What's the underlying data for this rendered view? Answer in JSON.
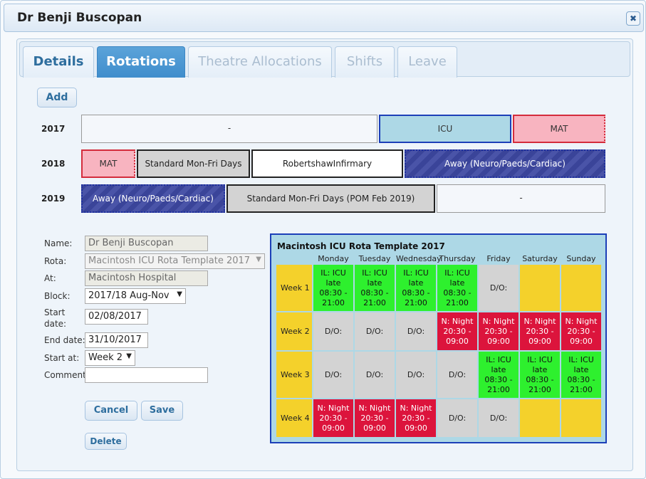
{
  "dialog": {
    "title": "Dr Benji Buscopan",
    "close_icon": "close-icon"
  },
  "tabs": [
    {
      "label": "Details",
      "active": false
    },
    {
      "label": "Rotations",
      "active": true
    },
    {
      "label": "Theatre Allocations",
      "active": false
    },
    {
      "label": "Shifts",
      "active": false
    },
    {
      "label": "Leave",
      "active": false
    }
  ],
  "add_label": "Add",
  "timeline": [
    {
      "year": "2017",
      "blocks": [
        {
          "label": "-",
          "style": "empty"
        },
        {
          "label": "ICU",
          "style": "icu"
        },
        {
          "label": "MAT",
          "style": "mat"
        }
      ]
    },
    {
      "year": "2018",
      "blocks": [
        {
          "label": "MAT",
          "style": "mat"
        },
        {
          "label": "Standard Mon-Fri Days",
          "style": "std"
        },
        {
          "label": "RobertshawInfirmary",
          "style": "hosp"
        },
        {
          "label": "Away (Neuro/Paeds/Cardiac)",
          "style": "away"
        }
      ]
    },
    {
      "year": "2019",
      "blocks": [
        {
          "label": "Away (Neuro/Paeds/Cardiac)",
          "style": "away"
        },
        {
          "label": "Standard Mon-Fri Days (POM Feb 2019)",
          "style": "std"
        },
        {
          "label": "-",
          "style": "empty"
        }
      ]
    }
  ],
  "form": {
    "name_label": "Name:",
    "name_value": "Dr Benji Buscopan",
    "rota_label": "Rota:",
    "rota_value": "Macintosh ICU Rota Template 2017",
    "at_label": "At:",
    "at_value": "Macintosh Hospital",
    "block_label": "Block:",
    "block_value": "2017/18 Aug-Nov",
    "start_date_label_1": "Start",
    "start_date_label_2": "date:",
    "start_date_value": "02/08/2017",
    "end_date_label": "End date:",
    "end_date_value": "31/10/2017",
    "start_at_label": "Start at:",
    "start_at_value": "Week 2",
    "comment_label": "Comment",
    "comment_value": "",
    "cancel_label": "Cancel",
    "save_label": "Save",
    "delete_label": "Delete"
  },
  "rota": {
    "title": "Macintosh ICU Rota Template 2017",
    "days": [
      "Monday",
      "Tuesday",
      "Wednesday",
      "Thursday",
      "Friday",
      "Saturday",
      "Sunday"
    ],
    "weeks": [
      {
        "label": "Week 1",
        "cells": [
          {
            "type": "green",
            "lines": [
              "IL: ICU",
              "late",
              "08:30 -",
              "21:00"
            ]
          },
          {
            "type": "green",
            "lines": [
              "IL: ICU",
              "late",
              "08:30 -",
              "21:00"
            ]
          },
          {
            "type": "green",
            "lines": [
              "IL: ICU",
              "late",
              "08:30 -",
              "21:00"
            ]
          },
          {
            "type": "green",
            "lines": [
              "IL: ICU",
              "late",
              "08:30 -",
              "21:00"
            ]
          },
          {
            "type": "grey",
            "lines": [
              "D/O:"
            ]
          },
          {
            "type": "yellow",
            "lines": []
          },
          {
            "type": "yellow",
            "lines": []
          }
        ]
      },
      {
        "label": "Week 2",
        "cells": [
          {
            "type": "grey",
            "lines": [
              "D/O:"
            ]
          },
          {
            "type": "grey",
            "lines": [
              "D/O:"
            ]
          },
          {
            "type": "grey",
            "lines": [
              "D/O:"
            ]
          },
          {
            "type": "red",
            "lines": [
              "N: Night",
              "20:30 -",
              "09:00"
            ]
          },
          {
            "type": "red",
            "lines": [
              "N: Night",
              "20:30 -",
              "09:00"
            ]
          },
          {
            "type": "red",
            "lines": [
              "N: Night",
              "20:30 -",
              "09:00"
            ]
          },
          {
            "type": "red",
            "lines": [
              "N: Night",
              "20:30 -",
              "09:00"
            ]
          }
        ]
      },
      {
        "label": "Week 3",
        "cells": [
          {
            "type": "grey",
            "lines": [
              "D/O:"
            ]
          },
          {
            "type": "grey",
            "lines": [
              "D/O:"
            ]
          },
          {
            "type": "grey",
            "lines": [
              "D/O:"
            ]
          },
          {
            "type": "grey",
            "lines": [
              "D/O:"
            ]
          },
          {
            "type": "green",
            "lines": [
              "IL: ICU",
              "late",
              "08:30 -",
              "21:00"
            ]
          },
          {
            "type": "green",
            "lines": [
              "IL: ICU",
              "late",
              "08:30 -",
              "21:00"
            ]
          },
          {
            "type": "green",
            "lines": [
              "IL: ICU",
              "late",
              "08:30 -",
              "21:00"
            ]
          }
        ]
      },
      {
        "label": "Week 4",
        "cells": [
          {
            "type": "red",
            "lines": [
              "N: Night",
              "20:30 -",
              "09:00"
            ]
          },
          {
            "type": "red",
            "lines": [
              "N: Night",
              "20:30 -",
              "09:00"
            ]
          },
          {
            "type": "red",
            "lines": [
              "N: Night",
              "20:30 -",
              "09:00"
            ]
          },
          {
            "type": "grey",
            "lines": [
              "D/O:"
            ]
          },
          {
            "type": "grey",
            "lines": [
              "D/O:"
            ]
          },
          {
            "type": "yellow",
            "lines": []
          },
          {
            "type": "yellow",
            "lines": []
          }
        ]
      }
    ]
  }
}
